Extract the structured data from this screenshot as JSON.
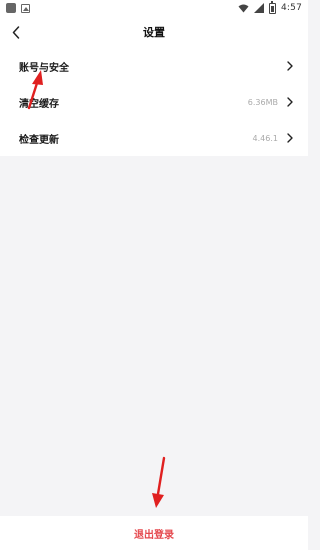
{
  "status_bar": {
    "time": "4:57",
    "icons": [
      "app-square-icon",
      "image-icon",
      "wifi-icon",
      "signal-icon",
      "battery-icon"
    ]
  },
  "nav": {
    "back_icon": "chevron-left-icon",
    "title": "设置"
  },
  "settings": {
    "items": [
      {
        "label": "账号与安全",
        "value": ""
      },
      {
        "label": "清空缓存",
        "value": "6.36MB"
      },
      {
        "label": "检查更新",
        "value": "4.46.1"
      }
    ]
  },
  "logout": {
    "label": "退出登录",
    "color": "#e5484d"
  },
  "annotations": {
    "arrow_color": "#e02020",
    "arrows": [
      "red-arrow-to-account-security",
      "red-arrow-to-logout"
    ]
  },
  "colors": {
    "background": "#f4f4f6",
    "surface": "#ffffff",
    "muted_text": "#aaaaaa"
  }
}
